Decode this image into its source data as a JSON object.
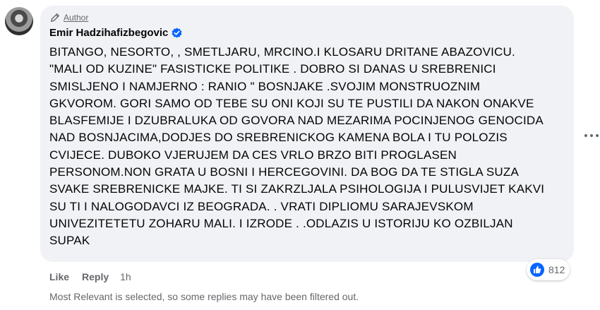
{
  "comment": {
    "badge": "Author",
    "author_name": "Emir Hadzihafizbegovic",
    "lines": [
      "BITANGO, NESORTO, , SMETLJARU, MRCINO.I KLOSARU DRITANE ABAZOVICU.",
      "\"MALI OD KUZINE\" FASISTICKE POLITIKE . DOBRO SI DANAS U SREBRENICI",
      "SMISLJENO I NAMJERNO : RANIO \" BOSNJAKE .SVOJIM MONSTRUOZNIM",
      "GKVOROM. GORI SAMO OD TEBE SU ONI KOJI SU TE PUSTILI DA NAKON ONAKVE",
      "BLASFEMIJE I DZUBRALUKA OD GOVORA NAD MEZARIMA POCINJENOG GENOCIDA",
      "NAD BOSNJACIMA,DODJES DO SREBRENICKOG KAMENA BOLA I TU POLOZIS",
      "CVIJECE. DUBOKO VJERUJEM DA CES VRLO BRZO BITI PROGLASEN",
      "PERSONOM.NON GRATA U BOSNI I HERCEGOVINI. DA BOG DA TE STIGLA SUZA",
      "SVAKE SREBRENICKE MAJKE. TI SI ZAKRZLJALA PSIHOLOGIJA I PULUSVIJET KAKVI",
      "SU TI I NALOGODAVCI IZ BEOGRADA. . VRATI DIPLIOMU SARAJEVSKOM",
      "UNIVEZITETETU ZOHARU MALI. I IZRODE . .ODLAZIS U ISTORIJU KO OZBILJAN",
      "SUPAK"
    ],
    "actions": {
      "like": "Like",
      "reply": "Reply",
      "time": "1h"
    },
    "reaction_count": "812",
    "accent_color": "#0866ff"
  },
  "filter_notice": "Most Relevant is selected, so some replies may have been filtered out.",
  "icons": {
    "author_badge": "pencil-icon",
    "verified": "verified-badge-icon",
    "more": "more-options-icon",
    "reaction": "like-reaction-icon"
  }
}
